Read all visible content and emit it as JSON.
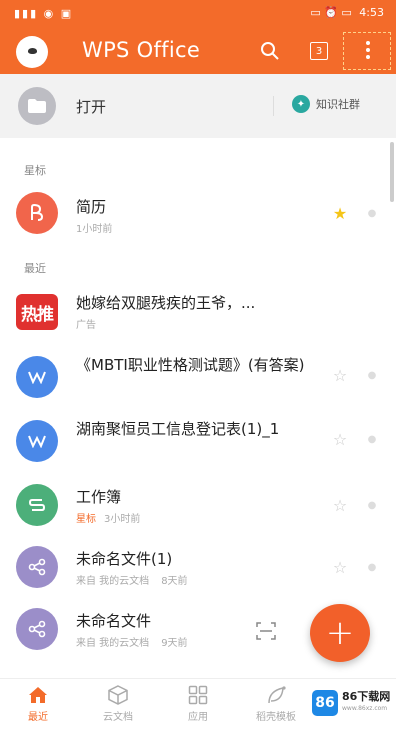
{
  "status_bar": {
    "left": "▮▮▮ ◉ ▣",
    "time": "4:53",
    "right_icons": "▭ ⏰ ▭"
  },
  "app_bar": {
    "title": "WPS Office",
    "tabs_count": "3"
  },
  "open_row": {
    "label": "打开",
    "community": "知识社群"
  },
  "sections": {
    "starred": "星标",
    "recent": "最近"
  },
  "starred_files": [
    {
      "name": "简历",
      "meta": "1小时前",
      "icon": "pdf-icon",
      "color": "#f1654b",
      "starred": true
    }
  ],
  "recent_files": [
    {
      "name": "她嫁给双腿残疾的王爷，...",
      "meta": "广告",
      "icon": "hot-ad-icon",
      "badge": "热推"
    },
    {
      "name": "《MBTI职业性格测试题》(有答案)",
      "meta": "",
      "icon": "word-icon",
      "color": "#4a88e8"
    },
    {
      "name": "湖南聚恒员工信息登记表(1)_1",
      "meta": "",
      "icon": "word-icon",
      "color": "#4a88e8"
    },
    {
      "name": "工作簿",
      "tag": "星标",
      "meta": "3小时前",
      "icon": "spreadsheet-icon",
      "color": "#4caf7a"
    },
    {
      "name": "未命名文件(1)",
      "tag": "来自 我的云文档",
      "meta": "8天前",
      "icon": "share-icon",
      "color": "#9b8ec9"
    },
    {
      "name": "未命名文件",
      "tag": "来自 我的云文档",
      "meta": "9天前",
      "icon": "share-icon",
      "color": "#9b8ec9"
    }
  ],
  "bottom_nav": [
    {
      "label": "最近",
      "icon": "home-icon",
      "active": true
    },
    {
      "label": "云文档",
      "icon": "cube-icon",
      "active": false
    },
    {
      "label": "应用",
      "icon": "grid-icon",
      "active": false
    },
    {
      "label": "稻壳模板",
      "icon": "leaf-icon",
      "active": false
    }
  ],
  "watermark": {
    "logo": "86",
    "name": "86下载网",
    "url": "www.86xz.com"
  },
  "colors": {
    "accent": "#f36b2a",
    "star": "#f5c518"
  }
}
